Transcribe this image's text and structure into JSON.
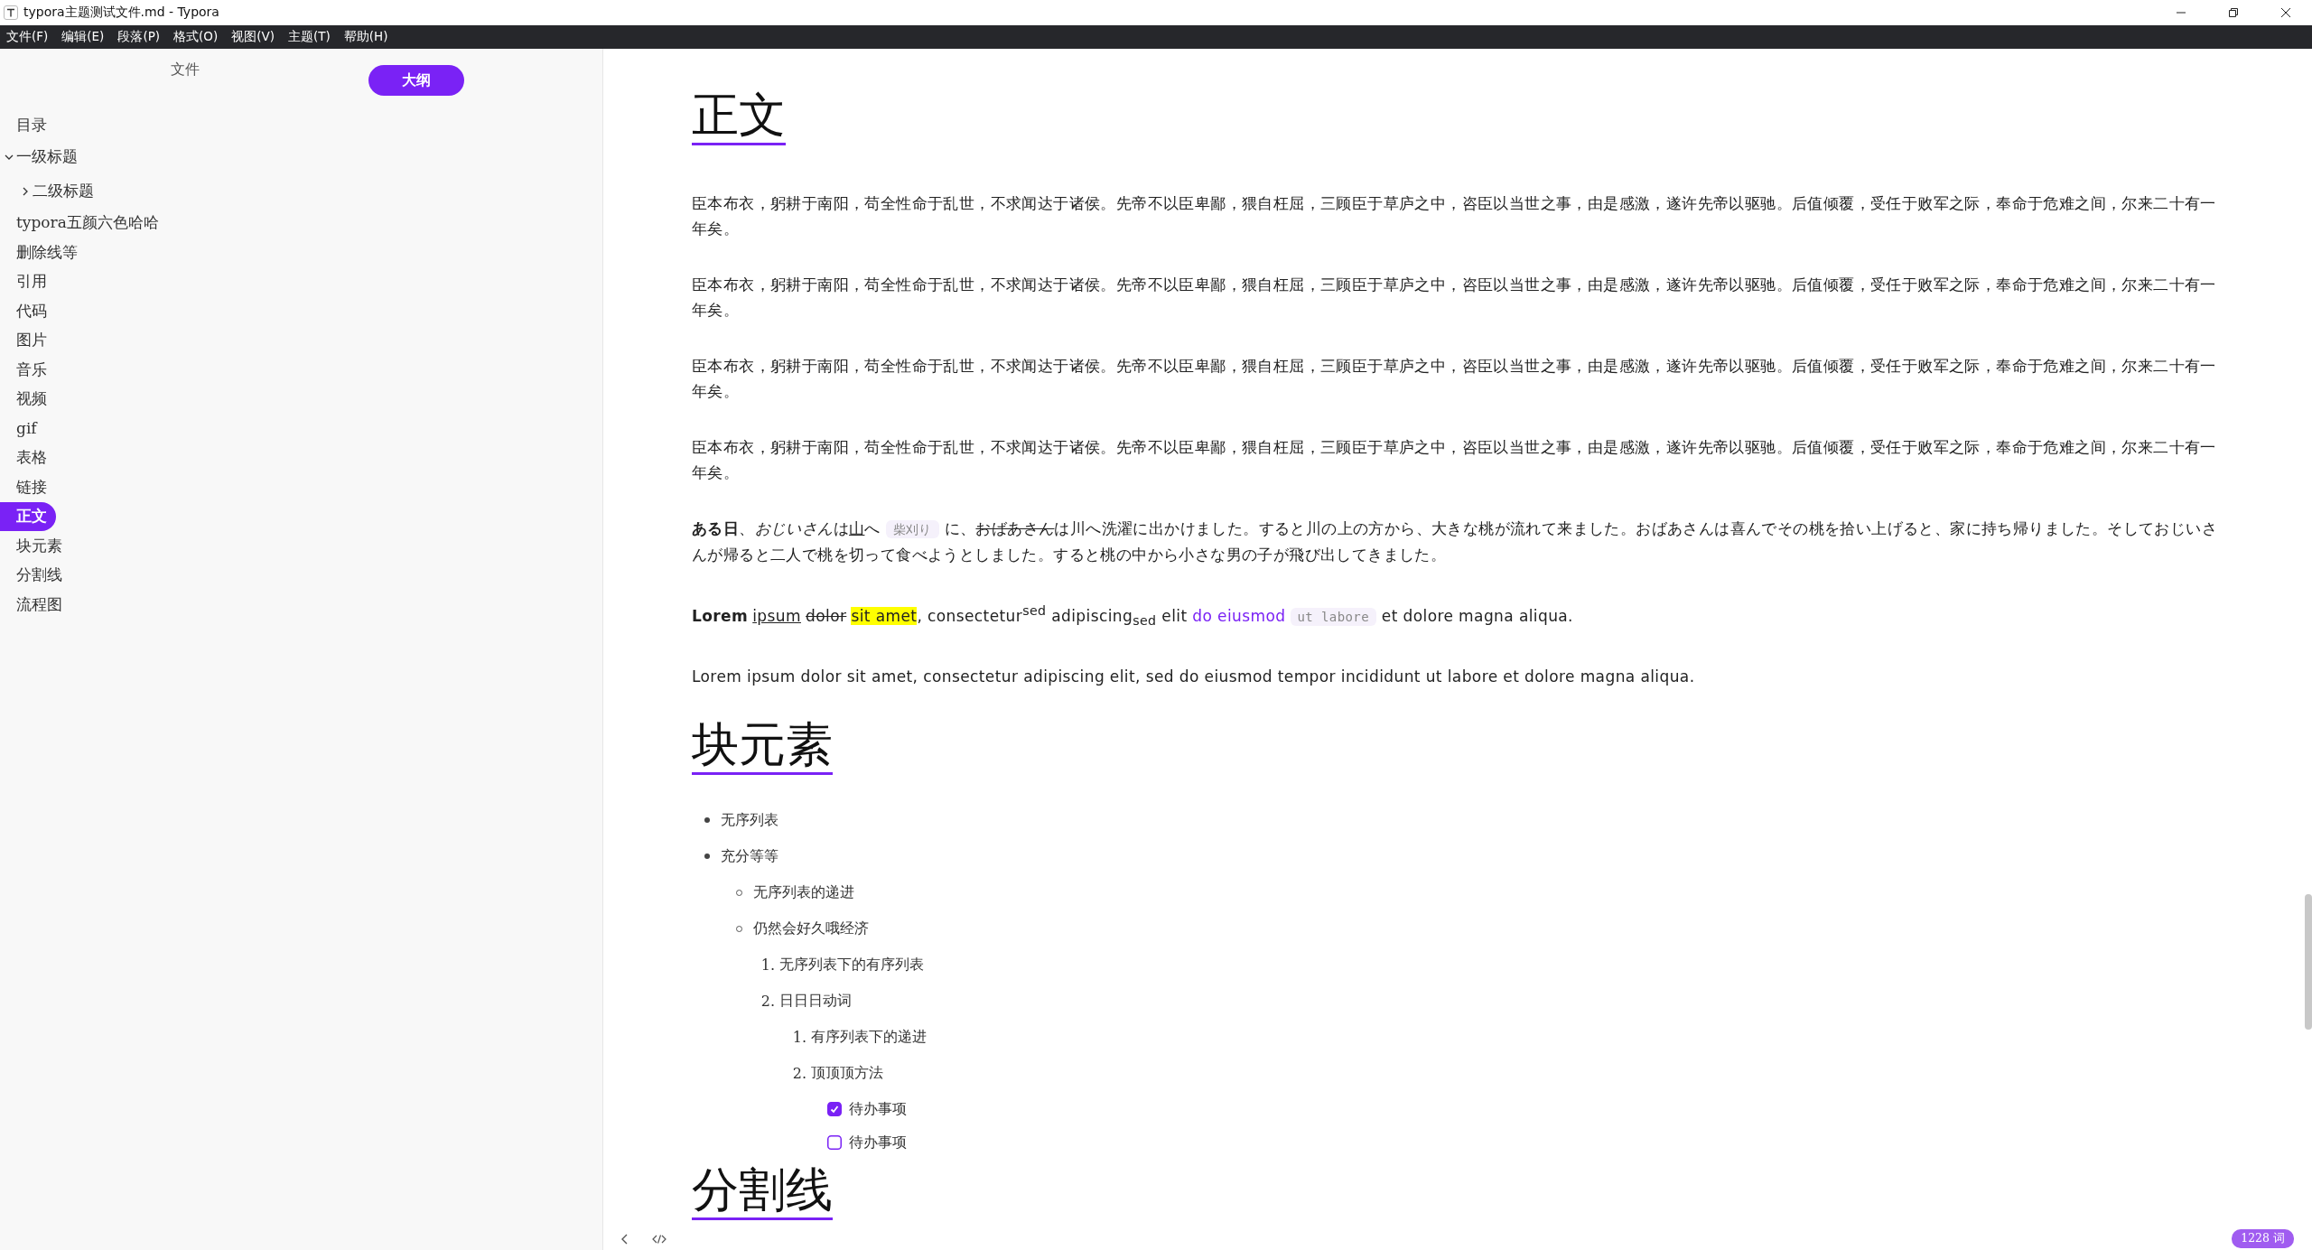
{
  "window": {
    "title": "typora主题测试文件.md - Typora"
  },
  "menu": [
    "文件(F)",
    "编辑(E)",
    "段落(P)",
    "格式(O)",
    "视图(V)",
    "主题(T)",
    "帮助(H)"
  ],
  "sidebar": {
    "tabs": [
      {
        "label": "文件",
        "selected": false
      },
      {
        "label": "大纲",
        "selected": true
      }
    ],
    "outline": [
      {
        "label": "目录",
        "selected": false
      },
      {
        "label": "一级标题",
        "selected": false,
        "expanded": true,
        "children": [
          {
            "label": "二级标题",
            "selected": false,
            "expanded": false
          }
        ]
      },
      {
        "label": "typora五颜六色哈哈",
        "selected": false
      },
      {
        "label": "删除线等",
        "selected": false
      },
      {
        "label": "引用",
        "selected": false
      },
      {
        "label": "代码",
        "selected": false
      },
      {
        "label": "图片",
        "selected": false
      },
      {
        "label": "音乐",
        "selected": false
      },
      {
        "label": "视频",
        "selected": false
      },
      {
        "label": "gif",
        "selected": false
      },
      {
        "label": "表格",
        "selected": false
      },
      {
        "label": "链接",
        "selected": false
      },
      {
        "label": "正文",
        "selected": true
      },
      {
        "label": "块元素",
        "selected": false
      },
      {
        "label": "分割线",
        "selected": false
      },
      {
        "label": "流程图",
        "selected": false
      }
    ]
  },
  "document": {
    "blocks": [
      {
        "kind": "heading",
        "text": "正文"
      },
      {
        "kind": "paragraph",
        "text": "臣本布衣，躬耕于南阳，苟全性命于乱世，不求闻达于诸侯。先帝不以臣卑鄙，猥自枉屈，三顾臣于草庐之中，咨臣以当世之事，由是感激，遂许先帝以驱驰。后值倾覆，受任于败军之际，奉命于危难之间，尔来二十有一年矣。"
      },
      {
        "kind": "paragraph",
        "text": "臣本布衣，躬耕于南阳，苟全性命于乱世，不求闻达于诸侯。先帝不以臣卑鄙，猥自枉屈，三顾臣于草庐之中，咨臣以当世之事，由是感激，遂许先帝以驱驰。后值倾覆，受任于败军之际，奉命于危难之间，尔来二十有一年矣。"
      },
      {
        "kind": "paragraph",
        "text": "臣本布衣，躬耕于南阳，苟全性命于乱世，不求闻达于诸侯。先帝不以臣卑鄙，猥自枉屈，三顾臣于草庐之中，咨臣以当世之事，由是感激，遂许先帝以驱驰。后值倾覆，受任于败军之际，奉命于危难之间，尔来二十有一年矣。"
      },
      {
        "kind": "paragraph",
        "text": "臣本布衣，躬耕于南阳，苟全性命于乱世，不求闻达于诸侯。先帝不以臣卑鄙，猥自枉屈，三顾臣于草庐之中，咨臣以当世之事，由是感激，遂许先帝以驱驰。后值倾覆，受任于败军之际，奉命于危难之间，尔来二十有一年矣。"
      },
      {
        "kind": "styled",
        "segments": [
          {
            "kind": "bold",
            "text": "ある日"
          },
          {
            "kind": "plain",
            "text": "、"
          },
          {
            "kind": "italic",
            "text": "おじいさん"
          },
          {
            "kind": "plain",
            "text": "は"
          },
          {
            "kind": "underline",
            "text": "山"
          },
          {
            "kind": "plain",
            "text": "へ "
          },
          {
            "kind": "code",
            "text": "柴刈り"
          },
          {
            "kind": "plain",
            "text": " に、"
          },
          {
            "kind": "strike",
            "text": "おばあさん"
          },
          {
            "kind": "plain",
            "text": "は川へ洗濯に出かけました。すると川の上の方から、大きな桃が流れて来ました。おばあさんは喜んでその桃を拾い上げると、家に持ち帰りました。そしておじいさんが帰ると二人で桃を切って食べようとしました。すると桃の中から小さな男の子が飛び出してきました。"
          }
        ]
      },
      {
        "kind": "styled",
        "segments": [
          {
            "kind": "bold",
            "text": "Lorem",
            "space_after": true
          },
          {
            "kind": "underline",
            "text": "ipsum",
            "space_after": true
          },
          {
            "kind": "strike",
            "text": "dolor",
            "space_after": true
          },
          {
            "kind": "highlight",
            "text": "sit amet"
          },
          {
            "kind": "plain",
            "text": ", consectetur"
          },
          {
            "kind": "sup",
            "text": "sed"
          },
          {
            "kind": "plain",
            "text": " adipiscing"
          },
          {
            "kind": "sub",
            "text": "sed"
          },
          {
            "kind": "plain",
            "text": " elit "
          },
          {
            "kind": "link",
            "text": "do eiusmod",
            "space_after": true
          },
          {
            "kind": "code",
            "text": "ut labore"
          },
          {
            "kind": "plain",
            "text": " et dolore magna aliqua."
          }
        ]
      },
      {
        "kind": "paragraph",
        "text": "Lorem ipsum dolor sit amet, consectetur adipiscing elit, sed do eiusmod tempor incididunt ut labore et dolore magna aliqua."
      },
      {
        "kind": "heading",
        "text": "块元素"
      },
      {
        "kind": "list",
        "items": [
          {
            "kind": "bullet",
            "text": "无序列表"
          },
          {
            "kind": "bullet",
            "text": "充分等等",
            "children": [
              {
                "kind": "circle",
                "text": "无序列表的递进"
              },
              {
                "kind": "circle",
                "text": "仍然会好久哦经济",
                "children": [
                  {
                    "kind": "number",
                    "number": "1.",
                    "text": "无序列表下的有序列表"
                  },
                  {
                    "kind": "number",
                    "number": "2.",
                    "text": "日日日动词",
                    "children": [
                      {
                        "kind": "number",
                        "number": "1.",
                        "text": "有序列表下的递进"
                      },
                      {
                        "kind": "number",
                        "number": "2.",
                        "text": "顶顶顶方法",
                        "children": [
                          {
                            "kind": "task",
                            "checked": true,
                            "text": "待办事项"
                          },
                          {
                            "kind": "task",
                            "checked": false,
                            "text": "待办事项"
                          }
                        ]
                      }
                    ]
                  }
                ]
              }
            ]
          }
        ]
      },
      {
        "kind": "heading",
        "text": "分割线"
      }
    ]
  },
  "status": {
    "word_count": "1228 词"
  }
}
